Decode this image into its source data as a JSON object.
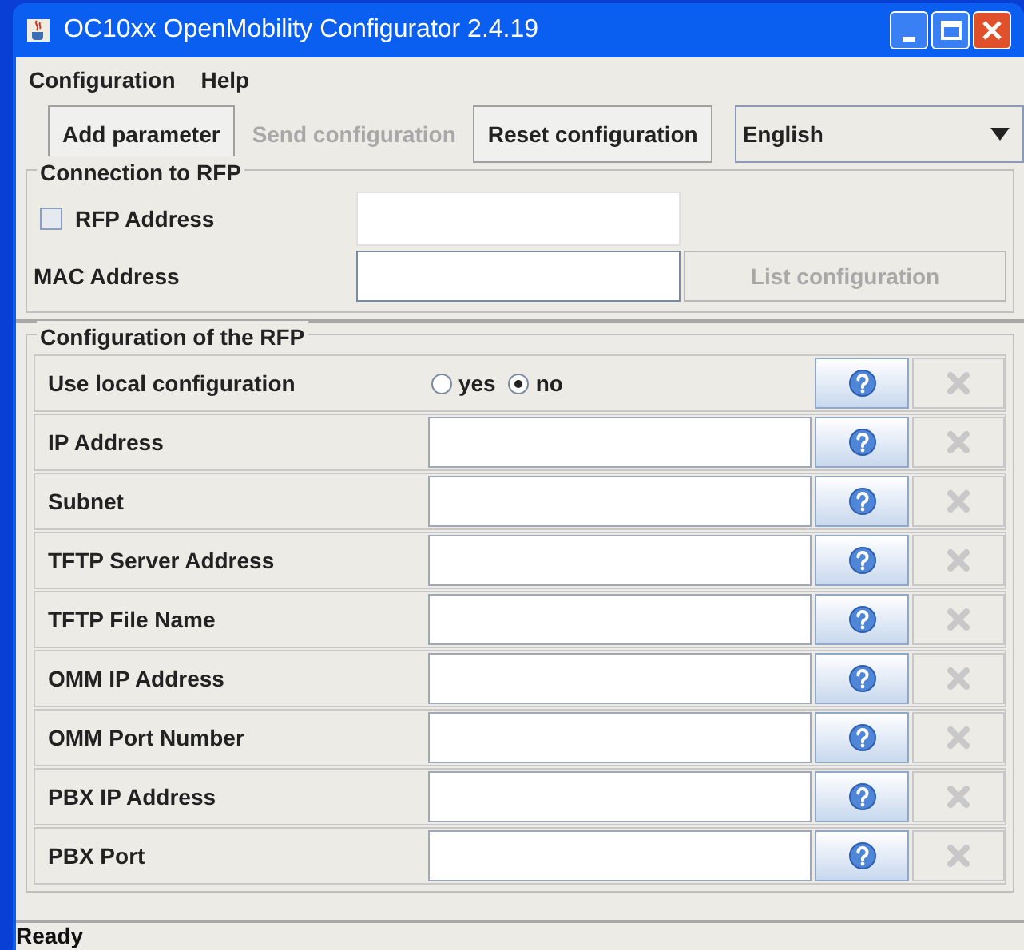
{
  "window": {
    "title": "OC10xx OpenMobility Configurator 2.4.19"
  },
  "menu": [
    "Configuration",
    "Help"
  ],
  "toolbar": [
    {
      "label": "Add parameter",
      "disabled": false
    },
    {
      "label": "Send configuration",
      "disabled": true
    },
    {
      "label": "Reset configuration",
      "disabled": false
    }
  ],
  "language": {
    "value": "English"
  },
  "connection": {
    "title": "Connection to RFP",
    "rfp_address": {
      "label": "RFP Address",
      "checked": false
    },
    "mac_address": {
      "label": "MAC Address"
    },
    "list_button": {
      "label": "List configuration",
      "disabled": true
    }
  },
  "configuration": {
    "title": "Configuration of the RFP",
    "rows": [
      {
        "kind": "radio",
        "label": "Use local configuration",
        "options": [
          {
            "label": "yes",
            "selected": false
          },
          {
            "label": "no",
            "selected": true
          }
        ]
      },
      {
        "kind": "text",
        "label": "IP Address"
      },
      {
        "kind": "text",
        "label": "Subnet"
      },
      {
        "kind": "text",
        "label": "TFTP Server Address"
      },
      {
        "kind": "text",
        "label": "TFTP File Name"
      },
      {
        "kind": "text",
        "label": "OMM IP Address"
      },
      {
        "kind": "text",
        "label": "OMM Port Number"
      },
      {
        "kind": "text",
        "label": "PBX IP Address"
      },
      {
        "kind": "text",
        "label": "PBX Port"
      }
    ]
  },
  "status_bar": "Ready"
}
